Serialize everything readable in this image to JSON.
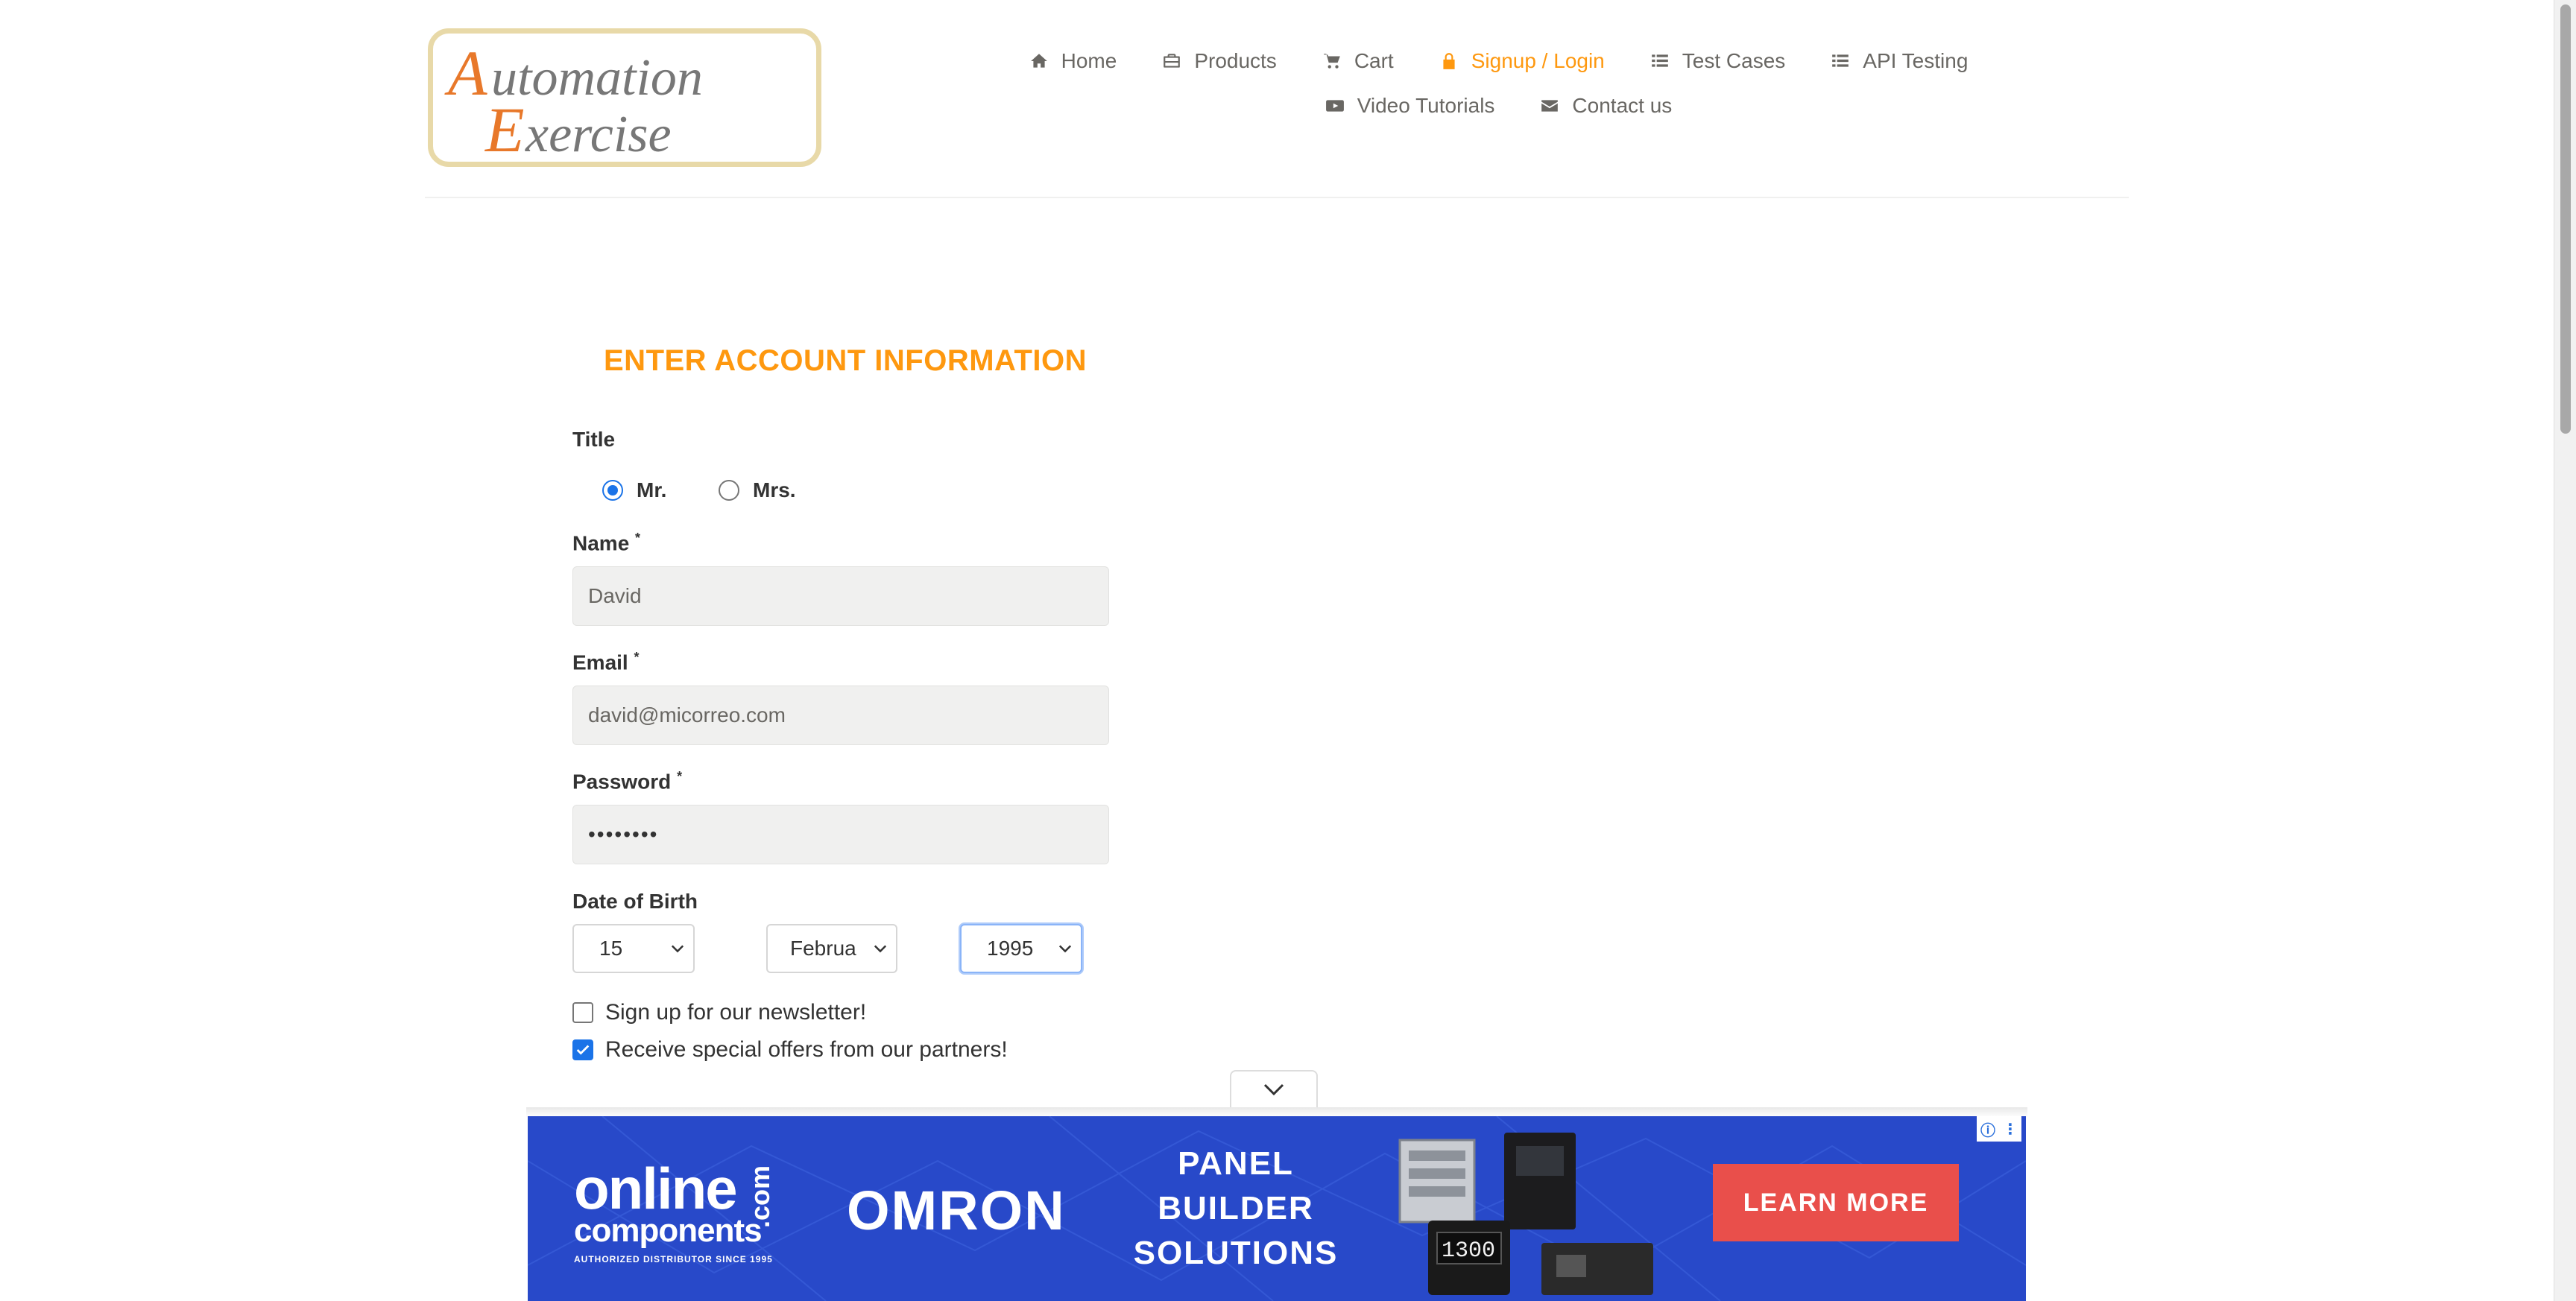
{
  "brand": {
    "logo_line1": "Automation",
    "logo_line2": "Exercise"
  },
  "nav": {
    "row1": [
      {
        "label": "Home",
        "icon": "home-icon",
        "active": false
      },
      {
        "label": "Products",
        "icon": "briefcase-icon",
        "active": false
      },
      {
        "label": "Cart",
        "icon": "cart-icon",
        "active": false
      },
      {
        "label": "Signup / Login",
        "icon": "lock-icon",
        "active": true
      },
      {
        "label": "Test Cases",
        "icon": "list-icon",
        "active": false
      },
      {
        "label": "API Testing",
        "icon": "list-icon",
        "active": false
      }
    ],
    "row2": [
      {
        "label": "Video Tutorials",
        "icon": "youtube-icon",
        "active": false
      },
      {
        "label": "Contact us",
        "icon": "envelope-icon",
        "active": false
      }
    ]
  },
  "form": {
    "heading": "ENTER ACCOUNT INFORMATION",
    "title_label": "Title",
    "title_options": [
      {
        "label": "Mr.",
        "selected": true
      },
      {
        "label": "Mrs.",
        "selected": false
      }
    ],
    "name_label": "Name",
    "name_value": "David",
    "email_label": "Email",
    "email_value": "david@micorreo.com",
    "password_label": "Password",
    "password_value": "••••••••",
    "required_mark": "*",
    "dob_label": "Date of Birth",
    "dob_day": "15",
    "dob_month": "Februa",
    "dob_year": "1995",
    "newsletter_label": "Sign up for our newsletter!",
    "newsletter_checked": false,
    "offers_label": "Receive special offers from our partners!",
    "offers_checked": true
  },
  "ad": {
    "brand_big": "online",
    "brand_small": "components",
    "brand_com": ".com",
    "brand_tagline": "AUTHORIZED DISTRIBUTOR SINCE 1995",
    "partner": "OMRON",
    "headline_1": "PANEL",
    "headline_2": "BUILDER",
    "headline_3": "SOLUTIONS",
    "device_readout": "1300",
    "cta": "LEARN MORE",
    "info_icon": "ⓘ",
    "menu_icon": "⋮"
  },
  "colors": {
    "accent": "#fe980f",
    "nav_text": "#696763",
    "input_bg": "#f0f0ef",
    "ad_bg": "#2849c9",
    "ad_cta": "#e94f4b",
    "check_blue": "#1a73e8"
  }
}
